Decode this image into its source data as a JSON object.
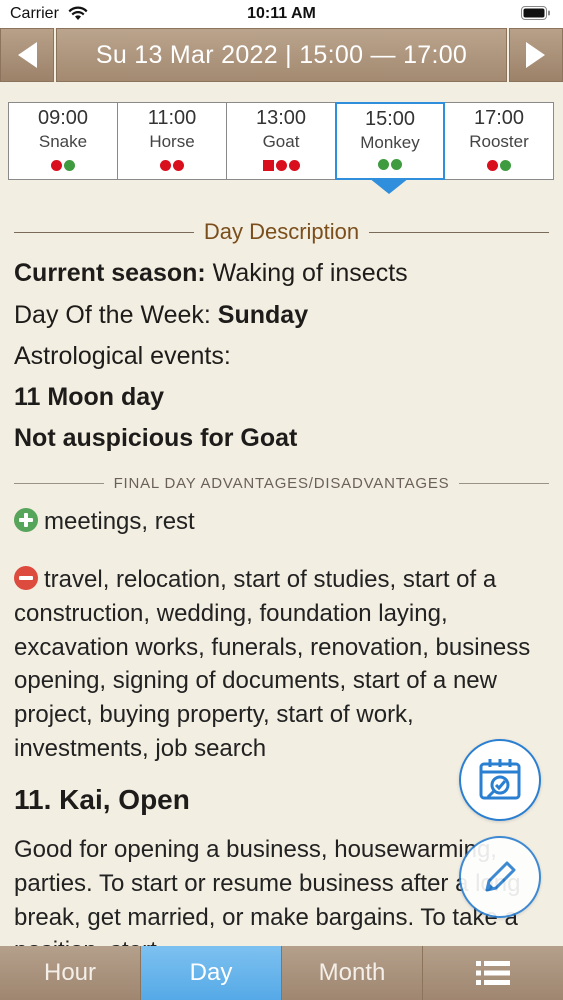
{
  "status_bar": {
    "carrier": "Carrier",
    "time": "10:11 AM"
  },
  "date_nav": {
    "date": "Su 13 Mar 2022 |  15:00 — 17:00"
  },
  "hours": [
    {
      "time": "09:00",
      "animal": "Snake",
      "marks": [
        "dot-red",
        "dot-green"
      ]
    },
    {
      "time": "11:00",
      "animal": "Horse",
      "marks": [
        "dot-red",
        "dot-red"
      ]
    },
    {
      "time": "13:00",
      "animal": "Goat",
      "marks": [
        "square-red",
        "dot-red",
        "dot-red"
      ]
    },
    {
      "time": "15:00",
      "animal": "Monkey",
      "marks": [
        "dot-green",
        "dot-green"
      ],
      "selected": true
    },
    {
      "time": "17:00",
      "animal": "Rooster",
      "marks": [
        "dot-red",
        "dot-green"
      ]
    }
  ],
  "day_description": {
    "header": "Day Description",
    "season_label": "Current season:",
    "season_value": "Waking of insects",
    "weekday_label": "Day Of the Week:",
    "weekday_value": "Sunday",
    "astro_label": "Astrological events:",
    "moon_day": "11 Moon day",
    "not_auspicious": "Not auspicious for Goat"
  },
  "advantages": {
    "header": "FINAL DAY ADVANTAGES/DISADVANTAGES",
    "good": "meetings, rest",
    "bad": "travel, relocation, start of studies, start of a construction, wedding, foundation laying, excavation works, funerals, renovation, business opening, signing of documents, start of a new project, buying property, start of work, investments, job search"
  },
  "officer": {
    "title": "11. Kai, Open",
    "description": "Good for opening a business, housewarming, parties. To start or resume business after a long break, get married, or make bargains. To take a position, start"
  },
  "tabs": {
    "hour": "Hour",
    "day": "Day",
    "month": "Month"
  },
  "colors": {
    "accent": "#2f8fdc",
    "auspicious": "#3f9b3f",
    "inauspicious": "#d90f1d",
    "header_brown": "#7a4f1c"
  },
  "icons": {
    "prev": "chevron-left-icon",
    "next": "chevron-right-icon",
    "calendar_fab": "calendar-check-icon",
    "edit_fab": "pencil-icon",
    "menu": "list-icon"
  }
}
